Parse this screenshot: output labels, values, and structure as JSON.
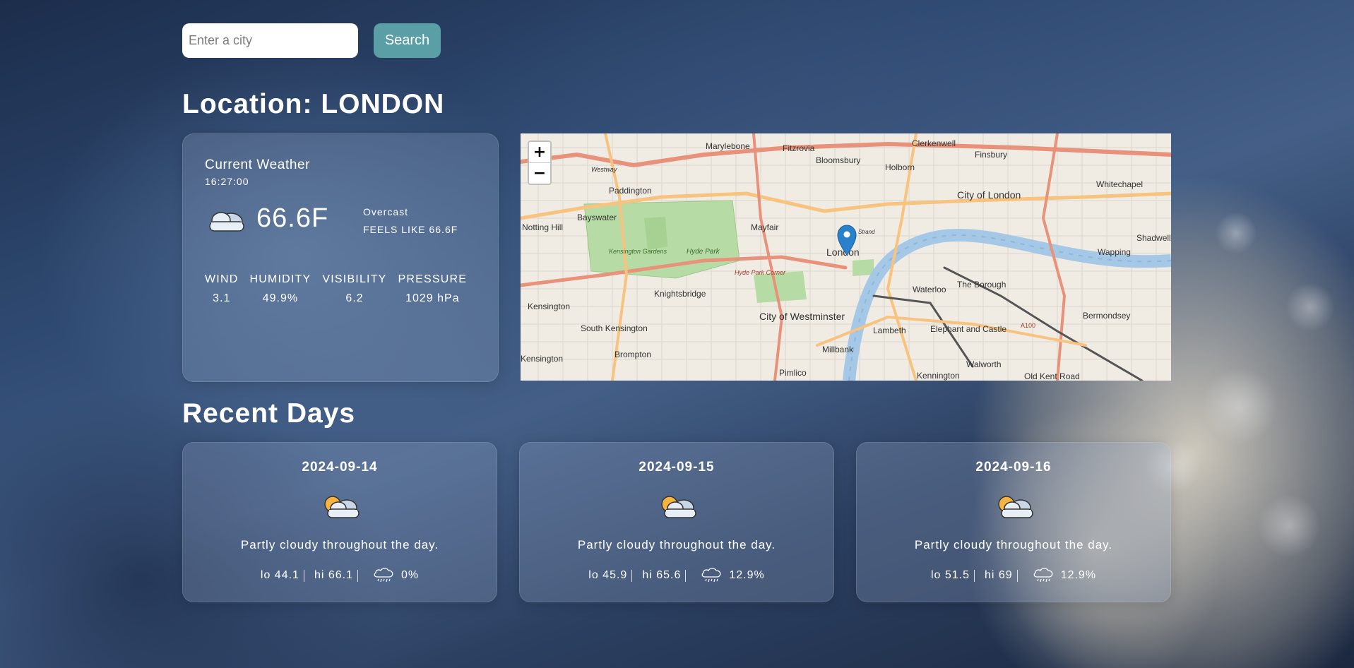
{
  "search": {
    "placeholder": "Enter a city",
    "value": "",
    "button_label": "Search"
  },
  "location": {
    "title": "Location: LONDON"
  },
  "current": {
    "title": "Current Weather",
    "time": "16:27:00",
    "icon": "cloudy-icon",
    "temp": "66.6F",
    "condition": "Overcast",
    "feels_like": "FEELS LIKE 66.6F",
    "stats": [
      {
        "label": "WIND",
        "value": "3.1"
      },
      {
        "label": "HUMIDITY",
        "value": "49.9%"
      },
      {
        "label": "VISIBILITY",
        "value": "6.2"
      },
      {
        "label": "PRESSURE",
        "value": "1029 hPa"
      }
    ]
  },
  "map": {
    "zoom_in": "+",
    "zoom_out": "−",
    "marker_label": "London",
    "labels": [
      "Marylebone",
      "Fitzrovia",
      "Bloomsbury",
      "Clerkenwell",
      "Finsbury",
      "Holborn",
      "Westway",
      "Paddington",
      "City of London",
      "Whitechapel",
      "Bayswater",
      "Mayfair",
      "Notting Hill",
      "Kensington Gardens",
      "Hyde Park",
      "Wapping",
      "Shadwell",
      "Strand",
      "Hyde Park Corner",
      "Waterloo",
      "The Borough",
      "Knightsbridge",
      "Kensington",
      "City of Westminster",
      "Lambeth",
      "Elephant and Castle",
      "Bermondsey",
      "South Kensington",
      "A100",
      "Brompton",
      "Millbank",
      "Walworth",
      "Pimlico",
      "Kennington",
      "Old Kent Road",
      "Kensington"
    ]
  },
  "recent": {
    "title": "Recent Days",
    "days": [
      {
        "date": "2024-09-14",
        "icon": "partly-cloudy-icon",
        "description": "Partly cloudy throughout the day.",
        "lo": "lo 44.1",
        "hi": "hi 66.1",
        "precip_icon": "rain-cloud-icon",
        "precip": "0%"
      },
      {
        "date": "2024-09-15",
        "icon": "partly-cloudy-icon",
        "description": "Partly cloudy throughout the day.",
        "lo": "lo 45.9",
        "hi": "hi 65.6",
        "precip_icon": "rain-cloud-icon",
        "precip": "12.9%"
      },
      {
        "date": "2024-09-16",
        "icon": "partly-cloudy-icon",
        "description": "Partly cloudy throughout the day.",
        "lo": "lo 51.5",
        "hi": "hi 69",
        "precip_icon": "rain-cloud-icon",
        "precip": "12.9%"
      }
    ]
  },
  "colors": {
    "search_button": "#5a9ea6",
    "map_marker": "#2a81cb",
    "river": "#a5c8e6",
    "park": "#b7dba5"
  }
}
